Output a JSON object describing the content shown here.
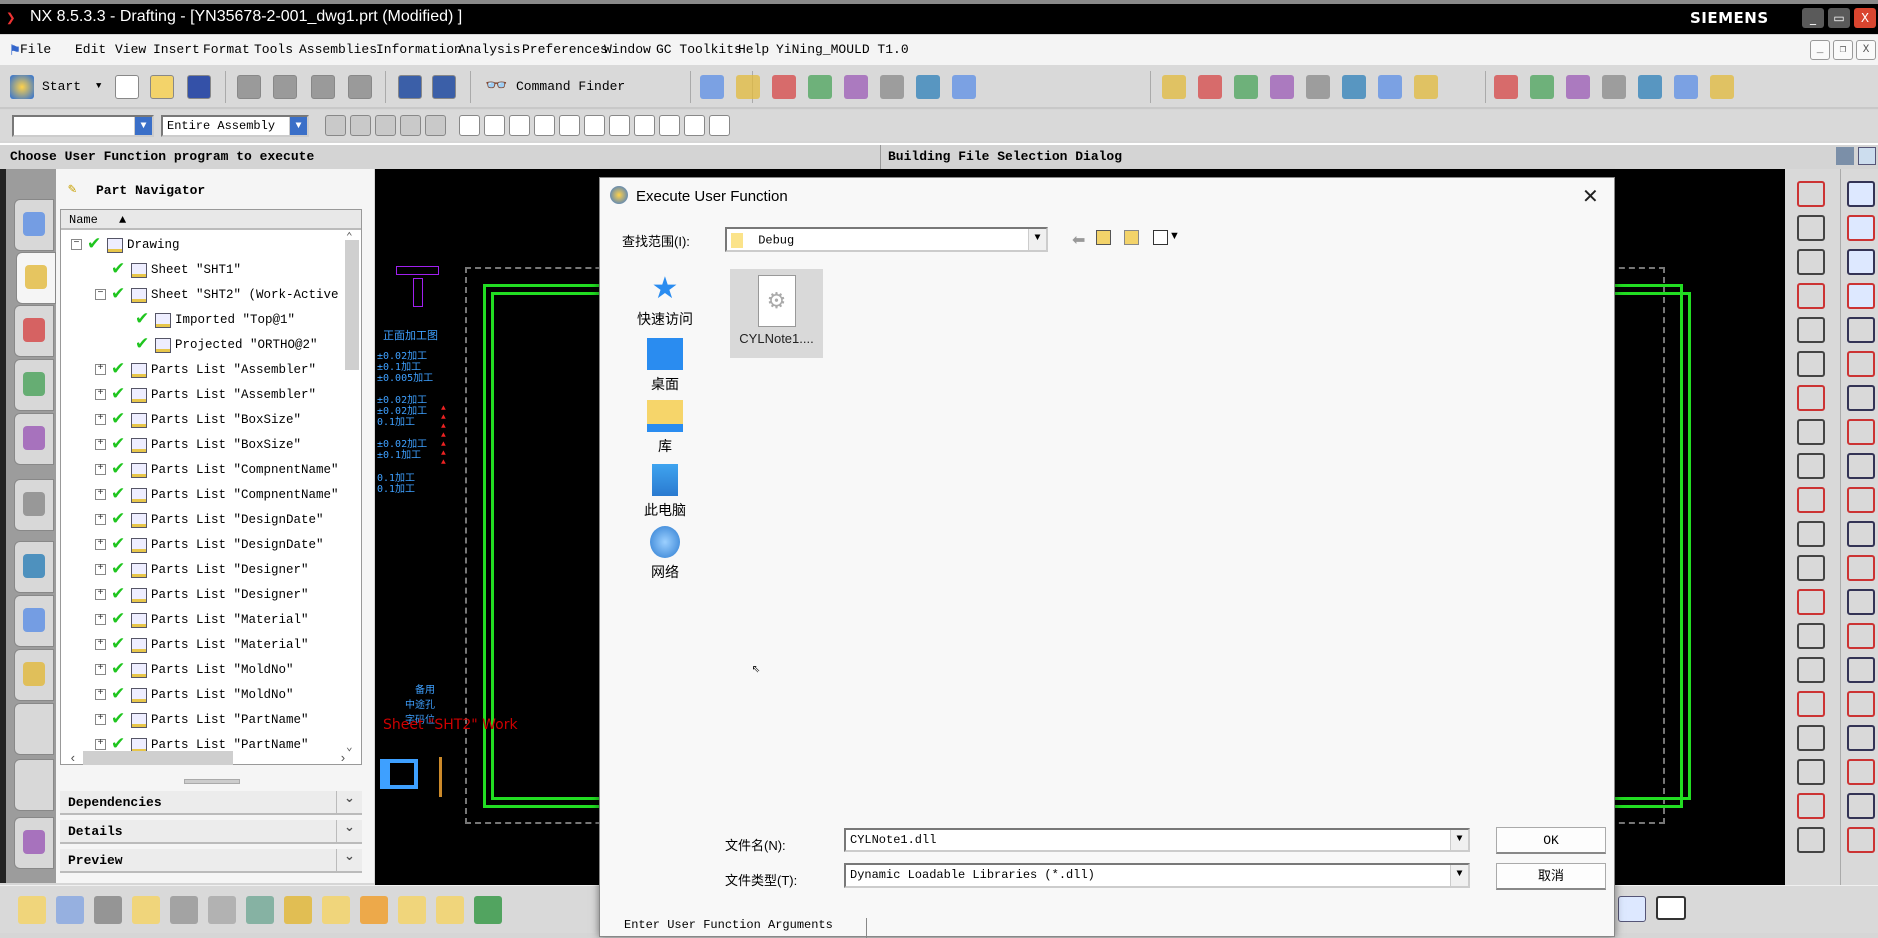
{
  "titlebar": {
    "title": "NX 8.5.3.3 - Drafting - [YN35678-2-001_dwg1.prt (Modified) ]",
    "brand": "SIEMENS"
  },
  "menubar": {
    "items": [
      "File",
      "Edit",
      "View",
      "Insert",
      "Format",
      "Tools",
      "Assemblies",
      "Information",
      "Analysis",
      "Preferences",
      "Window",
      "GC Toolkits",
      "Help",
      "YiNing_MOULD T1.0"
    ]
  },
  "toolbar1": {
    "start_label": "Start",
    "command_finder_label": "Command Finder",
    "icons": [
      "new-file-icon",
      "open-folder-icon",
      "save-icon",
      "cut-icon",
      "copy-icon",
      "paste-icon",
      "delete-icon",
      "undo-icon",
      "redo-icon"
    ],
    "right_icons": [
      "info-icon",
      "fit-view-icon",
      "layer-icon",
      "edit-icon",
      "measure-icon",
      "show-hide-icon",
      "dimension-icon",
      "ruler-icon",
      "line-icon",
      "arc-icon",
      "rectangle-icon",
      "polyline-icon",
      "profile-icon",
      "trim-icon",
      "section-line-icon",
      "section-icon",
      "table-icon",
      "tabular-note-icon",
      "balloon-icon",
      "leader-icon",
      "edit-table-icon",
      "edit-cell-icon",
      "parts-list-icon"
    ]
  },
  "toolbar2": {
    "filter_value": "",
    "scope_value": "Entire Assembly",
    "icons": [
      "select-icon",
      "select-feature-icon",
      "snap-icon",
      "snap-2-icon",
      "rect-select-icon",
      "snap-point-icon",
      "snap-center-icon",
      "end-point-icon",
      "mid-point-icon",
      "control-point-icon",
      "intersection-icon",
      "arc-center-icon",
      "quadrant-icon",
      "existing-point-icon",
      "point-on-curve-icon",
      "point-on-surface-icon"
    ]
  },
  "status": {
    "prompt": "Choose User Function program to execute",
    "message": "Building File Selection Dialog"
  },
  "navigator": {
    "title": "Part Navigator",
    "column": "Name",
    "rows": [
      {
        "level": 0,
        "toggle": "minus",
        "label": "Drawing"
      },
      {
        "level": 1,
        "toggle": "",
        "label": "Sheet \"SHT1\""
      },
      {
        "level": 1,
        "toggle": "minus",
        "label": "Sheet \"SHT2\" (Work-Active"
      },
      {
        "level": 2,
        "toggle": "",
        "label": "Imported \"Top@1\""
      },
      {
        "level": 2,
        "toggle": "",
        "label": "Projected \"ORTHO@2\""
      },
      {
        "level": 1,
        "toggle": "plus",
        "label": "Parts List \"Assembler\""
      },
      {
        "level": 1,
        "toggle": "plus",
        "label": "Parts List \"Assembler\""
      },
      {
        "level": 1,
        "toggle": "plus",
        "label": "Parts List \"BoxSize\""
      },
      {
        "level": 1,
        "toggle": "plus",
        "label": "Parts List \"BoxSize\""
      },
      {
        "level": 1,
        "toggle": "plus",
        "label": "Parts List \"CompnentName\""
      },
      {
        "level": 1,
        "toggle": "plus",
        "label": "Parts List \"CompnentName\""
      },
      {
        "level": 1,
        "toggle": "plus",
        "label": "Parts List \"DesignDate\""
      },
      {
        "level": 1,
        "toggle": "plus",
        "label": "Parts List \"DesignDate\""
      },
      {
        "level": 1,
        "toggle": "plus",
        "label": "Parts List \"Designer\""
      },
      {
        "level": 1,
        "toggle": "plus",
        "label": "Parts List \"Designer\""
      },
      {
        "level": 1,
        "toggle": "plus",
        "label": "Parts List \"Material\""
      },
      {
        "level": 1,
        "toggle": "plus",
        "label": "Parts List \"Material\""
      },
      {
        "level": 1,
        "toggle": "plus",
        "label": "Parts List \"MoldNo\""
      },
      {
        "level": 1,
        "toggle": "plus",
        "label": "Parts List \"MoldNo\""
      },
      {
        "level": 1,
        "toggle": "plus",
        "label": "Parts List \"PartName\""
      },
      {
        "level": 1,
        "toggle": "plus",
        "label": "Parts List \"PartName\""
      }
    ],
    "sections": [
      "Dependencies",
      "Details",
      "Preview"
    ]
  },
  "left_tabs": [
    "assembly-navigator-icon",
    "part-navigator-icon",
    "constraint-navigator-icon",
    "reuse-library-icon",
    "hd3d-tools-icon",
    "web-browser-icon",
    "history-icon",
    "system-materials-icon",
    "drafting-template-icon",
    "empty-tab-icon",
    "empty-tab-icon",
    "roles-icon"
  ],
  "canvas": {
    "sheet_label": "Sheet \"SHT2\" Work",
    "view_title": "正面加工图",
    "notes": [
      "±0.02加工",
      "±0.1加工",
      "±0.005加工",
      "±0.02加工",
      "±0.02加工",
      "0.1加工",
      "±0.02加工",
      "±0.1加工",
      "0.1加工",
      "0.1加工"
    ],
    "legend": [
      "备用",
      "中途孔",
      "字码位"
    ]
  },
  "dialog": {
    "title": "Execute User Function",
    "look_in_label": "查找范围(I):",
    "look_in_value": "Debug",
    "places": [
      "快速访问",
      "桌面",
      "库",
      "此电脑",
      "网络"
    ],
    "files": [
      {
        "name": "CYLNote1....",
        "selected": true
      }
    ],
    "filename_label": "文件名(N):",
    "filename_value": "CYLNote1.dll",
    "filetype_label": "文件类型(T):",
    "filetype_value": "Dynamic Loadable Libraries (*.dll)",
    "ok_label": "OK",
    "cancel_label": "取消",
    "args_tab": "Enter User Function Arguments"
  },
  "colors": {
    "drawing_border": "#22dd22",
    "annotation": "#3ea0ff",
    "sheet_label": "#cc0000",
    "check": "#1fc51f"
  }
}
